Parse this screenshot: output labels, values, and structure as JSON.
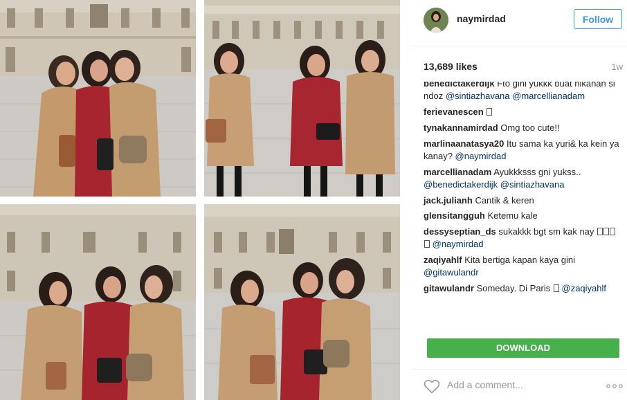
{
  "post": {
    "username": "naymirdad",
    "follow_label": "Follow",
    "likes": "13,689 likes",
    "time_ago": "1w",
    "download_label": "DOWNLOAD",
    "comment_placeholder": "Add a comment..."
  },
  "comments": [
    {
      "user": "benedictakerdijk",
      "parts": [
        {
          "t": "text",
          "v": "Fto gini yukkk buat nikahan si ndoz "
        },
        {
          "t": "mention",
          "v": "@sintiazhavana"
        },
        {
          "t": "text",
          "v": " "
        },
        {
          "t": "mention",
          "v": "@marcellianadam"
        }
      ]
    },
    {
      "user": "ferievanescen",
      "parts": [
        {
          "t": "emoji",
          "v": ""
        }
      ]
    },
    {
      "user": "tynakannamirdad",
      "parts": [
        {
          "t": "text",
          "v": "Omg too cute!!"
        }
      ]
    },
    {
      "user": "marlinaanatasya20",
      "parts": [
        {
          "t": "text",
          "v": "Itu sama ka yuri& ka kein ya kanay? "
        },
        {
          "t": "mention",
          "v": "@naymirdad"
        }
      ]
    },
    {
      "user": "marcellianadam",
      "parts": [
        {
          "t": "text",
          "v": "Ayukkksss gni yukss.. "
        },
        {
          "t": "mention",
          "v": "@benedictakerdijk"
        },
        {
          "t": "text",
          "v": " "
        },
        {
          "t": "mention",
          "v": "@sintiazhavana"
        }
      ]
    },
    {
      "user": "jack.julianh",
      "parts": [
        {
          "t": "text",
          "v": "Cantik & keren"
        }
      ]
    },
    {
      "user": "glensitangguh",
      "parts": [
        {
          "t": "text",
          "v": "Ketemu kale"
        }
      ]
    },
    {
      "user": "dessyseptian_ds",
      "parts": [
        {
          "t": "text",
          "v": "sukakkk bgt sm kak nay "
        },
        {
          "t": "emoji4",
          "v": ""
        },
        {
          "t": "mention",
          "v": "@naymirdad"
        }
      ]
    },
    {
      "user": "zaqiyahlf",
      "parts": [
        {
          "t": "text",
          "v": "Kita bertiga kapan kaya gini "
        },
        {
          "t": "mention",
          "v": "@gitawulandr"
        }
      ]
    },
    {
      "user": "gitawulandr",
      "parts": [
        {
          "t": "text",
          "v": "Someday. Di Paris "
        },
        {
          "t": "emoji",
          "v": ""
        },
        {
          "t": "text",
          "v": " "
        },
        {
          "t": "mention",
          "v": "@zaqiyahlf"
        }
      ]
    }
  ],
  "icons": {
    "heart": "heart-outline-icon",
    "more": "more-options-icon"
  },
  "colors": {
    "accent": "#3897f0",
    "download": "#46b04a",
    "mention": "#003569",
    "muted": "#999999"
  }
}
